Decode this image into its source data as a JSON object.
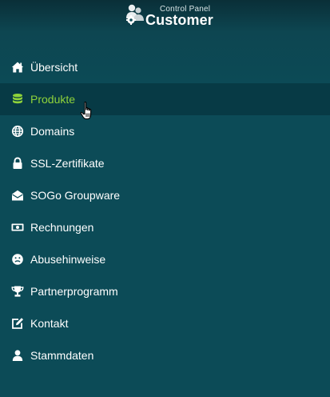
{
  "header": {
    "logo_small": "Control Panel",
    "logo_big": "Customer"
  },
  "nav": {
    "items": [
      {
        "label": "Übersicht",
        "icon": "home-icon",
        "active": false
      },
      {
        "label": "Produkte",
        "icon": "database-icon",
        "active": true
      },
      {
        "label": "Domains",
        "icon": "globe-icon",
        "active": false
      },
      {
        "label": "SSL-Zertifikate",
        "icon": "lock-icon",
        "active": false
      },
      {
        "label": "SOGo Groupware",
        "icon": "envelope-open-icon",
        "active": false
      },
      {
        "label": "Rechnungen",
        "icon": "money-bill-icon",
        "active": false
      },
      {
        "label": "Abusehinweise",
        "icon": "frown-icon",
        "active": false
      },
      {
        "label": "Partnerprogramm",
        "icon": "trophy-icon",
        "active": false
      },
      {
        "label": "Kontakt",
        "icon": "edit-icon",
        "active": false
      },
      {
        "label": "Stammdaten",
        "icon": "user-icon",
        "active": false
      }
    ]
  },
  "colors": {
    "background": "#0c4b57",
    "active_background": "#073a45",
    "active_text": "#8fd33a",
    "text": "#ffffff"
  }
}
